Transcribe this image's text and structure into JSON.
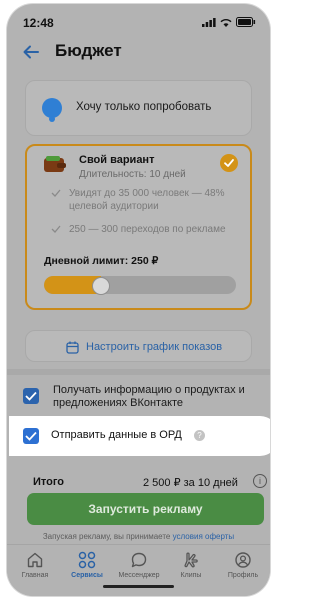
{
  "status_bar": {
    "time": "12:48"
  },
  "header": {
    "title": "Бюджет"
  },
  "options": {
    "try": {
      "label": "Хочу только попробовать"
    },
    "own": {
      "title": "Свой вариант",
      "subtitle": "Длительность: 10 дней",
      "features": [
        "Увидят до 35 000 человек — 48% целевой аудитории",
        "250 — 300 переходов по рекламе"
      ],
      "daily_limit_label": "Дневной лимит: 250 ₽",
      "slider_fraction": 0.25,
      "accent_color": "#d39317"
    }
  },
  "schedule": {
    "label": "Настроить график показов"
  },
  "checkboxes": {
    "info": {
      "label": "Получать информацию о продуктах и предложениях ВКонтакте",
      "checked": true
    },
    "ord": {
      "label": "Отправить данные в ОРД",
      "checked": true
    }
  },
  "total": {
    "label": "Итого",
    "value": "2 500 ₽ за 10 дней"
  },
  "launch_button": {
    "label": "Запустить рекламу",
    "color": "#4a8c44"
  },
  "disclaimer": {
    "text": "Запуская рекламу, вы принимаете",
    "link": "условия оферты"
  },
  "tabs": [
    {
      "label": "Главная",
      "icon": "home-icon",
      "active": false
    },
    {
      "label": "Сервисы",
      "icon": "services-icon",
      "active": true
    },
    {
      "label": "Мессенджер",
      "icon": "messenger-icon",
      "active": false
    },
    {
      "label": "Клипы",
      "icon": "clips-icon",
      "active": false
    },
    {
      "label": "Профиль",
      "icon": "profile-icon",
      "active": false
    }
  ]
}
